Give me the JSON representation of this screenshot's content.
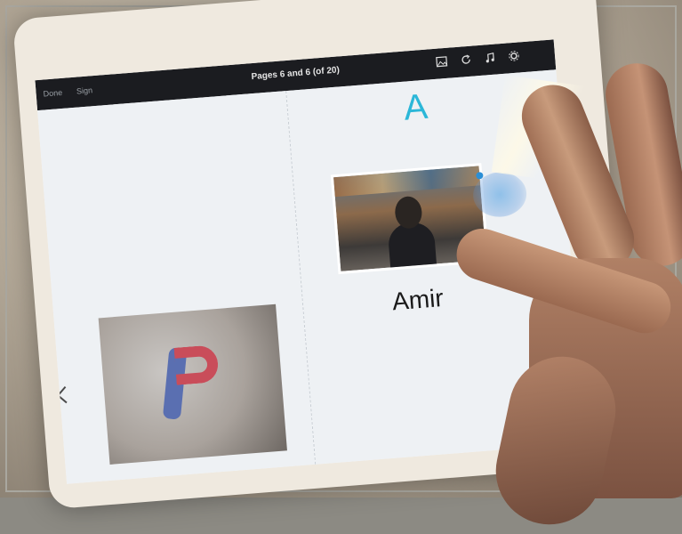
{
  "navbar": {
    "left_items": [
      "Done",
      "Sign"
    ],
    "title": "Pages 6 and 6 (of 20)",
    "icons": [
      "image-icon",
      "refresh-icon",
      "music-icon",
      "settings-icon"
    ]
  },
  "page": {
    "letter": "A",
    "name": "Amir"
  },
  "navigation": {
    "prev_icon": "chevron-left-icon"
  },
  "colors": {
    "letter": "#2bb7d8",
    "navbar_bg": "#1b1c20",
    "screen_bg": "#eef1f4"
  }
}
